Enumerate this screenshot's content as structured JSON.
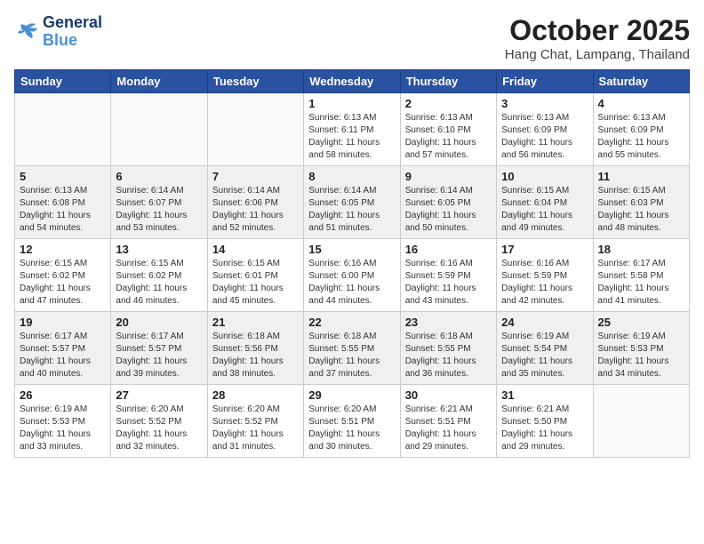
{
  "logo": {
    "line1": "General",
    "line2": "Blue"
  },
  "title": "October 2025",
  "subtitle": "Hang Chat, Lampang, Thailand",
  "headers": [
    "Sunday",
    "Monday",
    "Tuesday",
    "Wednesday",
    "Thursday",
    "Friday",
    "Saturday"
  ],
  "weeks": [
    [
      {
        "day": "",
        "info": ""
      },
      {
        "day": "",
        "info": ""
      },
      {
        "day": "",
        "info": ""
      },
      {
        "day": "1",
        "info": "Sunrise: 6:13 AM\nSunset: 6:11 PM\nDaylight: 11 hours\nand 58 minutes."
      },
      {
        "day": "2",
        "info": "Sunrise: 6:13 AM\nSunset: 6:10 PM\nDaylight: 11 hours\nand 57 minutes."
      },
      {
        "day": "3",
        "info": "Sunrise: 6:13 AM\nSunset: 6:09 PM\nDaylight: 11 hours\nand 56 minutes."
      },
      {
        "day": "4",
        "info": "Sunrise: 6:13 AM\nSunset: 6:09 PM\nDaylight: 11 hours\nand 55 minutes."
      }
    ],
    [
      {
        "day": "5",
        "info": "Sunrise: 6:13 AM\nSunset: 6:08 PM\nDaylight: 11 hours\nand 54 minutes."
      },
      {
        "day": "6",
        "info": "Sunrise: 6:14 AM\nSunset: 6:07 PM\nDaylight: 11 hours\nand 53 minutes."
      },
      {
        "day": "7",
        "info": "Sunrise: 6:14 AM\nSunset: 6:06 PM\nDaylight: 11 hours\nand 52 minutes."
      },
      {
        "day": "8",
        "info": "Sunrise: 6:14 AM\nSunset: 6:05 PM\nDaylight: 11 hours\nand 51 minutes."
      },
      {
        "day": "9",
        "info": "Sunrise: 6:14 AM\nSunset: 6:05 PM\nDaylight: 11 hours\nand 50 minutes."
      },
      {
        "day": "10",
        "info": "Sunrise: 6:15 AM\nSunset: 6:04 PM\nDaylight: 11 hours\nand 49 minutes."
      },
      {
        "day": "11",
        "info": "Sunrise: 6:15 AM\nSunset: 6:03 PM\nDaylight: 11 hours\nand 48 minutes."
      }
    ],
    [
      {
        "day": "12",
        "info": "Sunrise: 6:15 AM\nSunset: 6:02 PM\nDaylight: 11 hours\nand 47 minutes."
      },
      {
        "day": "13",
        "info": "Sunrise: 6:15 AM\nSunset: 6:02 PM\nDaylight: 11 hours\nand 46 minutes."
      },
      {
        "day": "14",
        "info": "Sunrise: 6:15 AM\nSunset: 6:01 PM\nDaylight: 11 hours\nand 45 minutes."
      },
      {
        "day": "15",
        "info": "Sunrise: 6:16 AM\nSunset: 6:00 PM\nDaylight: 11 hours\nand 44 minutes."
      },
      {
        "day": "16",
        "info": "Sunrise: 6:16 AM\nSunset: 5:59 PM\nDaylight: 11 hours\nand 43 minutes."
      },
      {
        "day": "17",
        "info": "Sunrise: 6:16 AM\nSunset: 5:59 PM\nDaylight: 11 hours\nand 42 minutes."
      },
      {
        "day": "18",
        "info": "Sunrise: 6:17 AM\nSunset: 5:58 PM\nDaylight: 11 hours\nand 41 minutes."
      }
    ],
    [
      {
        "day": "19",
        "info": "Sunrise: 6:17 AM\nSunset: 5:57 PM\nDaylight: 11 hours\nand 40 minutes."
      },
      {
        "day": "20",
        "info": "Sunrise: 6:17 AM\nSunset: 5:57 PM\nDaylight: 11 hours\nand 39 minutes."
      },
      {
        "day": "21",
        "info": "Sunrise: 6:18 AM\nSunset: 5:56 PM\nDaylight: 11 hours\nand 38 minutes."
      },
      {
        "day": "22",
        "info": "Sunrise: 6:18 AM\nSunset: 5:55 PM\nDaylight: 11 hours\nand 37 minutes."
      },
      {
        "day": "23",
        "info": "Sunrise: 6:18 AM\nSunset: 5:55 PM\nDaylight: 11 hours\nand 36 minutes."
      },
      {
        "day": "24",
        "info": "Sunrise: 6:19 AM\nSunset: 5:54 PM\nDaylight: 11 hours\nand 35 minutes."
      },
      {
        "day": "25",
        "info": "Sunrise: 6:19 AM\nSunset: 5:53 PM\nDaylight: 11 hours\nand 34 minutes."
      }
    ],
    [
      {
        "day": "26",
        "info": "Sunrise: 6:19 AM\nSunset: 5:53 PM\nDaylight: 11 hours\nand 33 minutes."
      },
      {
        "day": "27",
        "info": "Sunrise: 6:20 AM\nSunset: 5:52 PM\nDaylight: 11 hours\nand 32 minutes."
      },
      {
        "day": "28",
        "info": "Sunrise: 6:20 AM\nSunset: 5:52 PM\nDaylight: 11 hours\nand 31 minutes."
      },
      {
        "day": "29",
        "info": "Sunrise: 6:20 AM\nSunset: 5:51 PM\nDaylight: 11 hours\nand 30 minutes."
      },
      {
        "day": "30",
        "info": "Sunrise: 6:21 AM\nSunset: 5:51 PM\nDaylight: 11 hours\nand 29 minutes."
      },
      {
        "day": "31",
        "info": "Sunrise: 6:21 AM\nSunset: 5:50 PM\nDaylight: 11 hours\nand 29 minutes."
      },
      {
        "day": "",
        "info": ""
      }
    ]
  ]
}
